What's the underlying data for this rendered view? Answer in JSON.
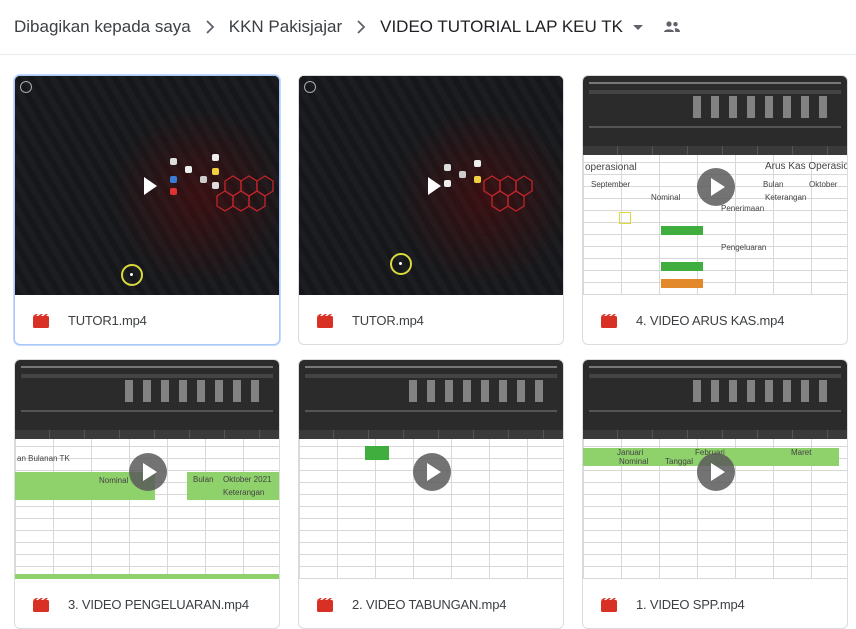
{
  "breadcrumb": {
    "items": [
      "Dibagikan kepada saya",
      "KKN Pakisjajar",
      "VIDEO TUTORIAL LAP KEU TK"
    ]
  },
  "colors": {
    "video_icon": "#d93025",
    "selected_border": "#a8c7fa",
    "sheet_green": "#8fd16b"
  },
  "files": [
    {
      "name": "TUTOR1.mp4",
      "icon": "video-file-icon",
      "thumb": "dark-video",
      "selected": true
    },
    {
      "name": "TUTOR.mp4",
      "icon": "video-file-icon",
      "thumb": "dark-video",
      "selected": false
    },
    {
      "name": "4. VIDEO ARUS KAS.mp4",
      "icon": "video-file-icon",
      "thumb": "spreadsheet",
      "selected": false
    },
    {
      "name": "3. VIDEO PENGELUARAN.mp4",
      "icon": "video-file-icon",
      "thumb": "spreadsheet",
      "selected": false
    },
    {
      "name": "2. VIDEO TABUNGAN.mp4",
      "icon": "video-file-icon",
      "thumb": "spreadsheet",
      "selected": false
    },
    {
      "name": "1. VIDEO SPP.mp4",
      "icon": "video-file-icon",
      "thumb": "spreadsheet",
      "selected": false
    }
  ],
  "thumb_text": {
    "arus_kas": {
      "title": "Arus Kas Operasional",
      "left": "operasional",
      "month1": "September",
      "month2": "Oktober",
      "month3": "Bulan",
      "nominal": "Nominal",
      "keterangan": "Keterangan",
      "penerimaan": "Penerimaan",
      "pengeluaran": "Pengeluaran"
    },
    "pengeluaran": {
      "title": "an Bulanan TK",
      "bulan": "Bulan",
      "month": "Oktober 2021",
      "nominal": "Nominal",
      "keterangan": "Keterangan"
    },
    "spp": {
      "januari": "Januari",
      "februari": "Februari",
      "maret": "Maret",
      "nominal": "Nominal",
      "tanggal": "Tanggal"
    }
  }
}
